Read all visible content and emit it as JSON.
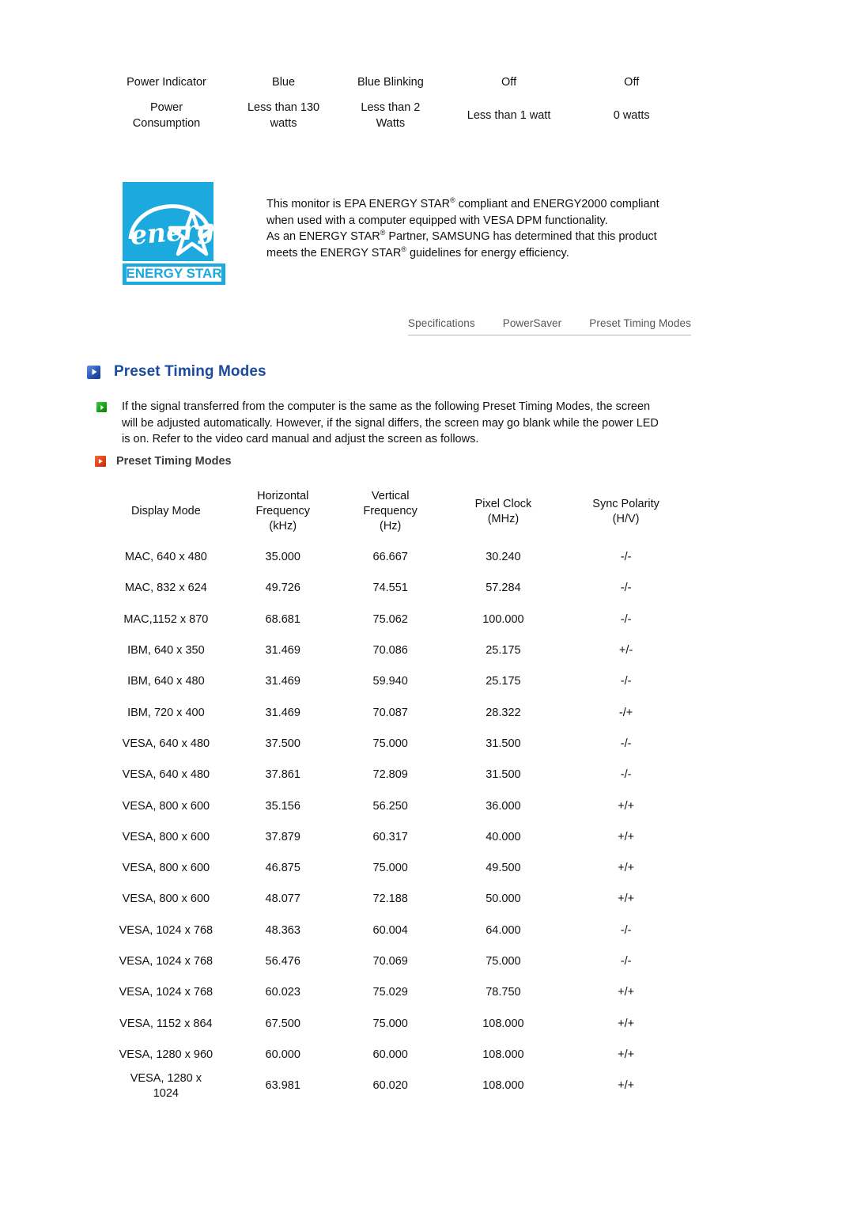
{
  "powersaver": {
    "rows": [
      {
        "label": "Power Indicator",
        "cells": [
          "Blue",
          "Blue Blinking",
          "Off",
          "Off"
        ]
      },
      {
        "label": "Power\nConsumption",
        "label_line1": "Power",
        "label_line2": "Consumption",
        "cells": [
          "Less than 130\nwatts",
          "Less than 2\nWatts",
          "Less than 1 watt",
          "0 watts"
        ]
      }
    ],
    "power_consumption_values": {
      "normal_line1": "Less than 130",
      "normal_line2": "watts",
      "sleep_line1": "Less than 2",
      "sleep_line2": "Watts",
      "power_off": "Less than 1 watt",
      "mech_off": "0 watts"
    }
  },
  "energy_star": {
    "logo_word": "energy",
    "logo_banner": "ENERGY STAR",
    "logo_color": "#1CA9DD",
    "paragraph1_a": "This monitor is EPA ENERGY STAR",
    "paragraph1_b": " compliant and ENERGY2000 compliant when used with a computer equipped with VESA DPM functionality.",
    "paragraph2_a": "As an ENERGY STAR",
    "paragraph2_b": " Partner, SAMSUNG has determined that this product meets the ENERGY STAR",
    "paragraph2_c": " guidelines for energy efficiency.",
    "registered_mark": "®"
  },
  "tabs": [
    {
      "label": "Specifications"
    },
    {
      "label": "PowerSaver"
    },
    {
      "label": "Preset Timing Modes"
    }
  ],
  "section": {
    "heading": "Preset Timing Modes",
    "heading_color": "#1a4b9c",
    "intro": "If the signal transferred from the computer is the same as the following Preset Timing Modes, the screen will be adjusted automatically. However, if the signal differs, the screen may go blank while the power LED is on. Refer to the video card manual and adjust the screen as follows.",
    "subheading": "Preset Timing Modes"
  },
  "chart_data": {
    "type": "table",
    "title": "Preset Timing Modes",
    "columns": [
      {
        "line1": "Display Mode",
        "line2": "",
        "line3": ""
      },
      {
        "line1": "Horizontal",
        "line2": "Frequency",
        "line3": "(kHz)"
      },
      {
        "line1": "Vertical",
        "line2": "Frequency",
        "line3": "(Hz)"
      },
      {
        "line1": "Pixel Clock",
        "line2": "(MHz)",
        "line3": ""
      },
      {
        "line1": "Sync Polarity",
        "line2": "(H/V)",
        "line3": ""
      }
    ],
    "rows": [
      {
        "mode": "MAC, 640 x 480",
        "h_freq": "35.000",
        "v_freq": "66.667",
        "pixel_clock": "30.240",
        "sync": "-/-"
      },
      {
        "mode": "MAC, 832 x 624",
        "h_freq": "49.726",
        "v_freq": "74.551",
        "pixel_clock": "57.284",
        "sync": "-/-"
      },
      {
        "mode": "MAC,1152 x 870",
        "h_freq": "68.681",
        "v_freq": "75.062",
        "pixel_clock": "100.000",
        "sync": "-/-"
      },
      {
        "mode": "IBM, 640 x 350",
        "h_freq": "31.469",
        "v_freq": "70.086",
        "pixel_clock": "25.175",
        "sync": "+/-"
      },
      {
        "mode": "IBM, 640 x 480",
        "h_freq": "31.469",
        "v_freq": "59.940",
        "pixel_clock": "25.175",
        "sync": "-/-"
      },
      {
        "mode": "IBM, 720 x 400",
        "h_freq": "31.469",
        "v_freq": "70.087",
        "pixel_clock": "28.322",
        "sync": "-/+"
      },
      {
        "mode": "VESA, 640 x 480",
        "h_freq": "37.500",
        "v_freq": "75.000",
        "pixel_clock": "31.500",
        "sync": "-/-"
      },
      {
        "mode": "VESA, 640 x 480",
        "h_freq": "37.861",
        "v_freq": "72.809",
        "pixel_clock": "31.500",
        "sync": "-/-"
      },
      {
        "mode": "VESA, 800 x 600",
        "h_freq": "35.156",
        "v_freq": "56.250",
        "pixel_clock": "36.000",
        "sync": "+/+"
      },
      {
        "mode": "VESA, 800 x 600",
        "h_freq": "37.879",
        "v_freq": "60.317",
        "pixel_clock": "40.000",
        "sync": "+/+"
      },
      {
        "mode": "VESA, 800 x 600",
        "h_freq": "46.875",
        "v_freq": "75.000",
        "pixel_clock": "49.500",
        "sync": "+/+"
      },
      {
        "mode": "VESA, 800 x 600",
        "h_freq": "48.077",
        "v_freq": "72.188",
        "pixel_clock": "50.000",
        "sync": "+/+"
      },
      {
        "mode": "VESA, 1024 x 768",
        "h_freq": "48.363",
        "v_freq": "60.004",
        "pixel_clock": "64.000",
        "sync": "-/-"
      },
      {
        "mode": "VESA, 1024 x 768",
        "h_freq": "56.476",
        "v_freq": "70.069",
        "pixel_clock": "75.000",
        "sync": "-/-"
      },
      {
        "mode": "VESA, 1024 x 768",
        "h_freq": "60.023",
        "v_freq": "75.029",
        "pixel_clock": "78.750",
        "sync": "+/+"
      },
      {
        "mode": "VESA, 1152 x 864",
        "h_freq": "67.500",
        "v_freq": "75.000",
        "pixel_clock": "108.000",
        "sync": "+/+"
      },
      {
        "mode": "VESA, 1280 x 960",
        "h_freq": "60.000",
        "v_freq": "60.000",
        "pixel_clock": "108.000",
        "sync": "+/+"
      },
      {
        "mode": "VESA, 1280 x 1024",
        "h_freq": "63.981",
        "v_freq": "60.020",
        "pixel_clock": "108.000",
        "sync": "+/+"
      }
    ]
  }
}
